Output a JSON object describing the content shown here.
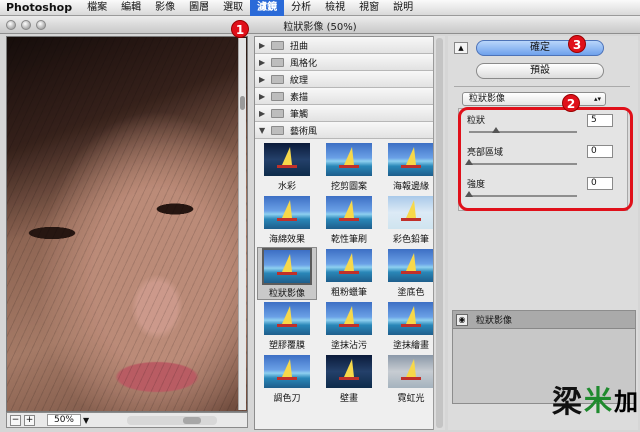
{
  "menubar": {
    "app": "Photoshop",
    "items": [
      "檔案",
      "編輯",
      "影像",
      "圖層",
      "選取",
      "濾鏡",
      "分析",
      "檢視",
      "視窗",
      "說明"
    ],
    "active_index": 5
  },
  "window": {
    "title": "粒狀影像 (50%)"
  },
  "preview": {
    "zoom": "50%"
  },
  "gallery": {
    "categories": [
      {
        "label": "扭曲",
        "expanded": false
      },
      {
        "label": "風格化",
        "expanded": false
      },
      {
        "label": "紋理",
        "expanded": false
      },
      {
        "label": "素描",
        "expanded": false
      },
      {
        "label": "筆觸",
        "expanded": false
      },
      {
        "label": "藝術風",
        "expanded": true
      }
    ],
    "filters": [
      {
        "label": "水彩",
        "style": "dark"
      },
      {
        "label": "挖剪圖案",
        "style": "normal"
      },
      {
        "label": "海報邊緣",
        "style": "normal"
      },
      {
        "label": "海綿效果",
        "style": "normal"
      },
      {
        "label": "乾性筆刷",
        "style": "normal"
      },
      {
        "label": "彩色鉛筆",
        "style": "light"
      },
      {
        "label": "粒狀影像",
        "style": "normal",
        "selected": true
      },
      {
        "label": "粗粉蠟筆",
        "style": "normal"
      },
      {
        "label": "塗底色",
        "style": "normal"
      },
      {
        "label": "塑膠覆膜",
        "style": "normal"
      },
      {
        "label": "塗抹沾污",
        "style": "normal"
      },
      {
        "label": "塗抹繪畫",
        "style": "normal"
      },
      {
        "label": "調色刀",
        "style": "normal"
      },
      {
        "label": "壁畫",
        "style": "dark"
      },
      {
        "label": "霓虹光",
        "style": "gray"
      }
    ]
  },
  "settings": {
    "ok_label": "確定",
    "preset_label": "預設",
    "filter_select": "粒狀影像",
    "params": [
      {
        "label": "粒狀",
        "value": "5",
        "fraction": 0.25
      },
      {
        "label": "亮部區域",
        "value": "0",
        "fraction": 0.0
      },
      {
        "label": "強度",
        "value": "0",
        "fraction": 0.0
      }
    ]
  },
  "layers": {
    "items": [
      "粒狀影像"
    ]
  },
  "annotations": {
    "badge1": "1",
    "badge2": "2",
    "badge3": "3"
  },
  "colors": {
    "accent": "#2a6ad8",
    "annotation": "#e0101a"
  }
}
